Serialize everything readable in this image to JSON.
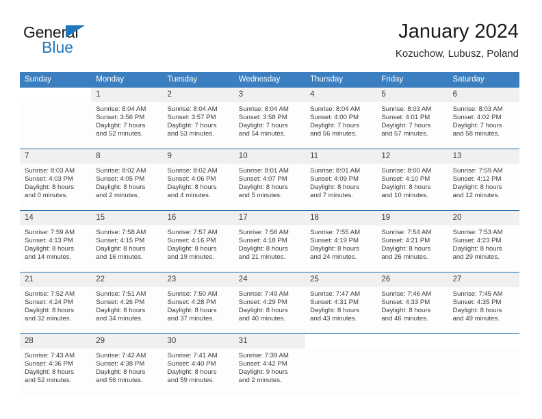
{
  "logo": {
    "word1": "General",
    "word2": "Blue",
    "accent_color": "#1f76bc"
  },
  "header": {
    "title": "January 2024",
    "subtitle": "Kozuchow, Lubusz, Poland"
  },
  "calendar": {
    "header_bg": "#3b7fc0",
    "weekdays": [
      "Sunday",
      "Monday",
      "Tuesday",
      "Wednesday",
      "Thursday",
      "Friday",
      "Saturday"
    ],
    "weeks": [
      [
        {
          "day": "",
          "lines": []
        },
        {
          "day": "1",
          "lines": [
            "Sunrise: 8:04 AM",
            "Sunset: 3:56 PM",
            "Daylight: 7 hours",
            "and 52 minutes."
          ]
        },
        {
          "day": "2",
          "lines": [
            "Sunrise: 8:04 AM",
            "Sunset: 3:57 PM",
            "Daylight: 7 hours",
            "and 53 minutes."
          ]
        },
        {
          "day": "3",
          "lines": [
            "Sunrise: 8:04 AM",
            "Sunset: 3:58 PM",
            "Daylight: 7 hours",
            "and 54 minutes."
          ]
        },
        {
          "day": "4",
          "lines": [
            "Sunrise: 8:04 AM",
            "Sunset: 4:00 PM",
            "Daylight: 7 hours",
            "and 56 minutes."
          ]
        },
        {
          "day": "5",
          "lines": [
            "Sunrise: 8:03 AM",
            "Sunset: 4:01 PM",
            "Daylight: 7 hours",
            "and 57 minutes."
          ]
        },
        {
          "day": "6",
          "lines": [
            "Sunrise: 8:03 AM",
            "Sunset: 4:02 PM",
            "Daylight: 7 hours",
            "and 58 minutes."
          ]
        }
      ],
      [
        {
          "day": "7",
          "lines": [
            "Sunrise: 8:03 AM",
            "Sunset: 4:03 PM",
            "Daylight: 8 hours",
            "and 0 minutes."
          ]
        },
        {
          "day": "8",
          "lines": [
            "Sunrise: 8:02 AM",
            "Sunset: 4:05 PM",
            "Daylight: 8 hours",
            "and 2 minutes."
          ]
        },
        {
          "day": "9",
          "lines": [
            "Sunrise: 8:02 AM",
            "Sunset: 4:06 PM",
            "Daylight: 8 hours",
            "and 4 minutes."
          ]
        },
        {
          "day": "10",
          "lines": [
            "Sunrise: 8:01 AM",
            "Sunset: 4:07 PM",
            "Daylight: 8 hours",
            "and 5 minutes."
          ]
        },
        {
          "day": "11",
          "lines": [
            "Sunrise: 8:01 AM",
            "Sunset: 4:09 PM",
            "Daylight: 8 hours",
            "and 7 minutes."
          ]
        },
        {
          "day": "12",
          "lines": [
            "Sunrise: 8:00 AM",
            "Sunset: 4:10 PM",
            "Daylight: 8 hours",
            "and 10 minutes."
          ]
        },
        {
          "day": "13",
          "lines": [
            "Sunrise: 7:59 AM",
            "Sunset: 4:12 PM",
            "Daylight: 8 hours",
            "and 12 minutes."
          ]
        }
      ],
      [
        {
          "day": "14",
          "lines": [
            "Sunrise: 7:59 AM",
            "Sunset: 4:13 PM",
            "Daylight: 8 hours",
            "and 14 minutes."
          ]
        },
        {
          "day": "15",
          "lines": [
            "Sunrise: 7:58 AM",
            "Sunset: 4:15 PM",
            "Daylight: 8 hours",
            "and 16 minutes."
          ]
        },
        {
          "day": "16",
          "lines": [
            "Sunrise: 7:57 AM",
            "Sunset: 4:16 PM",
            "Daylight: 8 hours",
            "and 19 minutes."
          ]
        },
        {
          "day": "17",
          "lines": [
            "Sunrise: 7:56 AM",
            "Sunset: 4:18 PM",
            "Daylight: 8 hours",
            "and 21 minutes."
          ]
        },
        {
          "day": "18",
          "lines": [
            "Sunrise: 7:55 AM",
            "Sunset: 4:19 PM",
            "Daylight: 8 hours",
            "and 24 minutes."
          ]
        },
        {
          "day": "19",
          "lines": [
            "Sunrise: 7:54 AM",
            "Sunset: 4:21 PM",
            "Daylight: 8 hours",
            "and 26 minutes."
          ]
        },
        {
          "day": "20",
          "lines": [
            "Sunrise: 7:53 AM",
            "Sunset: 4:23 PM",
            "Daylight: 8 hours",
            "and 29 minutes."
          ]
        }
      ],
      [
        {
          "day": "21",
          "lines": [
            "Sunrise: 7:52 AM",
            "Sunset: 4:24 PM",
            "Daylight: 8 hours",
            "and 32 minutes."
          ]
        },
        {
          "day": "22",
          "lines": [
            "Sunrise: 7:51 AM",
            "Sunset: 4:26 PM",
            "Daylight: 8 hours",
            "and 34 minutes."
          ]
        },
        {
          "day": "23",
          "lines": [
            "Sunrise: 7:50 AM",
            "Sunset: 4:28 PM",
            "Daylight: 8 hours",
            "and 37 minutes."
          ]
        },
        {
          "day": "24",
          "lines": [
            "Sunrise: 7:49 AM",
            "Sunset: 4:29 PM",
            "Daylight: 8 hours",
            "and 40 minutes."
          ]
        },
        {
          "day": "25",
          "lines": [
            "Sunrise: 7:47 AM",
            "Sunset: 4:31 PM",
            "Daylight: 8 hours",
            "and 43 minutes."
          ]
        },
        {
          "day": "26",
          "lines": [
            "Sunrise: 7:46 AM",
            "Sunset: 4:33 PM",
            "Daylight: 8 hours",
            "and 46 minutes."
          ]
        },
        {
          "day": "27",
          "lines": [
            "Sunrise: 7:45 AM",
            "Sunset: 4:35 PM",
            "Daylight: 8 hours",
            "and 49 minutes."
          ]
        }
      ],
      [
        {
          "day": "28",
          "lines": [
            "Sunrise: 7:43 AM",
            "Sunset: 4:36 PM",
            "Daylight: 8 hours",
            "and 52 minutes."
          ]
        },
        {
          "day": "29",
          "lines": [
            "Sunrise: 7:42 AM",
            "Sunset: 4:38 PM",
            "Daylight: 8 hours",
            "and 56 minutes."
          ]
        },
        {
          "day": "30",
          "lines": [
            "Sunrise: 7:41 AM",
            "Sunset: 4:40 PM",
            "Daylight: 8 hours",
            "and 59 minutes."
          ]
        },
        {
          "day": "31",
          "lines": [
            "Sunrise: 7:39 AM",
            "Sunset: 4:42 PM",
            "Daylight: 9 hours",
            "and 2 minutes."
          ]
        },
        {
          "day": "",
          "lines": []
        },
        {
          "day": "",
          "lines": []
        },
        {
          "day": "",
          "lines": []
        }
      ]
    ]
  }
}
